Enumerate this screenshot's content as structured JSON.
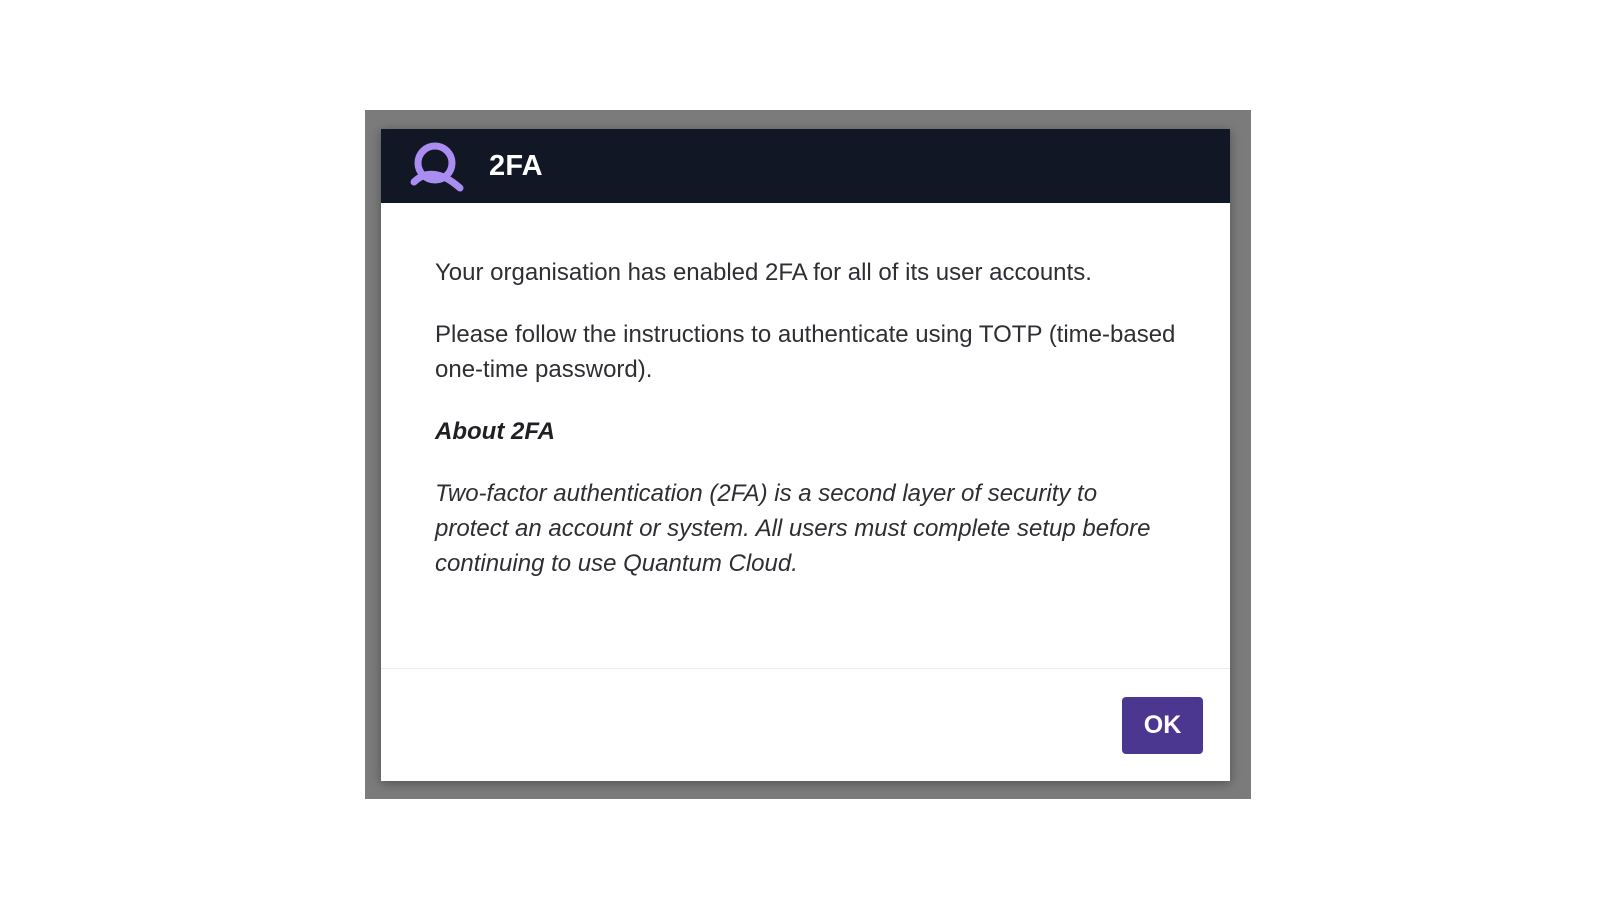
{
  "dialog": {
    "title": "2FA",
    "logo_icon": "quantum-logo-icon",
    "paragraphs": {
      "p1": "Your organisation has enabled 2FA for all of its user accounts.",
      "p2": "Please follow the instructions to authenticate using TOTP (time-based one-time password)."
    },
    "about_heading": "About 2FA",
    "about_text": "Two-factor authentication (2FA) is a second layer of security to protect an account or system. All users must complete setup before continuing to use Quantum Cloud.",
    "ok_label": "OK"
  },
  "colors": {
    "header_bg": "#111724",
    "accent": "#4b3790",
    "logo": "#a98df0",
    "backdrop": "#7b7b7b"
  }
}
